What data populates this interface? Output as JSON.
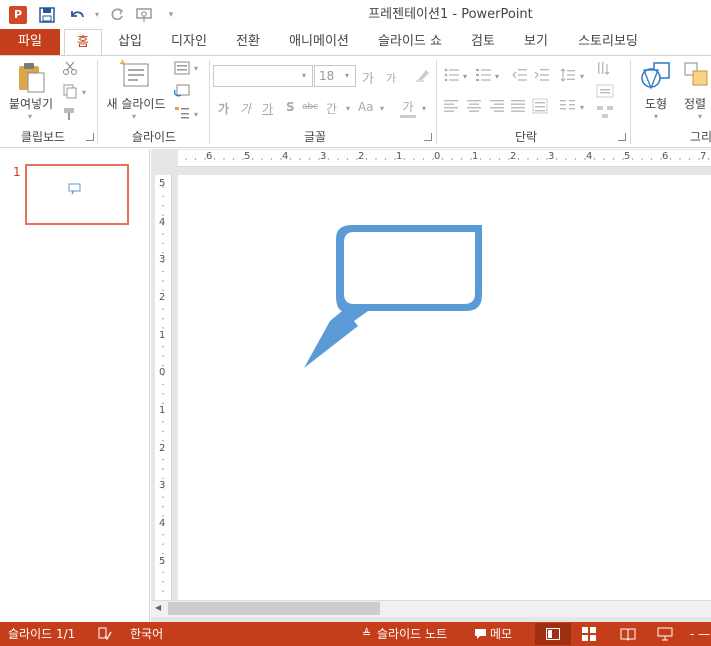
{
  "window": {
    "title": "프레젠테이션1 - PowerPoint",
    "app_icon_letter": "P"
  },
  "quick_access": {
    "save_icon": "save-icon",
    "undo_icon": "undo-icon",
    "redo_icon": "redo-icon",
    "present_icon": "present-from-start-icon",
    "customize_icon": "customize-qat-icon"
  },
  "tabs": [
    "파일",
    "홈",
    "삽입",
    "디자인",
    "전환",
    "애니메이션",
    "슬라이드 쇼",
    "검토",
    "보기",
    "스토리보딩"
  ],
  "ribbon": {
    "clipboard": {
      "paste_label": "붙여넣기",
      "group_label": "클립보드"
    },
    "slides": {
      "new_slide_label": "새 슬라이드",
      "group_label": "슬라이드"
    },
    "font": {
      "font_name_value": "",
      "font_size_value": "18",
      "group_label": "글꼴",
      "btn_grow": "가",
      "btn_shrink": "가",
      "btn_bold": "가",
      "btn_italic": "가",
      "btn_underline": "가",
      "btn_shadow": "S",
      "btn_strike": "abc",
      "btn_spacing": "간",
      "btn_case": "Aa",
      "btn_color": "가"
    },
    "paragraph": {
      "group_label": "단락"
    },
    "drawing": {
      "shapes_label": "도형",
      "arrange_label": "정렬",
      "group_label_partial": "그리"
    }
  },
  "slide_pane": {
    "slide_number": "1"
  },
  "rulers": {
    "horizontal": [
      "6",
      "5",
      "4",
      "3",
      "2",
      "1",
      "0",
      "1",
      "2",
      "3",
      "4",
      "5",
      "6",
      "7"
    ],
    "vertical": [
      "5",
      "4",
      "3",
      "2",
      "1",
      "0",
      "1",
      "2",
      "3",
      "4",
      "5"
    ]
  },
  "shape": {
    "type": "speech-bubble-callout",
    "color": "#5b9bd5"
  },
  "status_bar": {
    "slide_indicator": "슬라이드 1/1",
    "language": "한국어",
    "notes_label": "슬라이드 노트",
    "comments_label": "메모",
    "bg_color": "#c43e1c"
  }
}
